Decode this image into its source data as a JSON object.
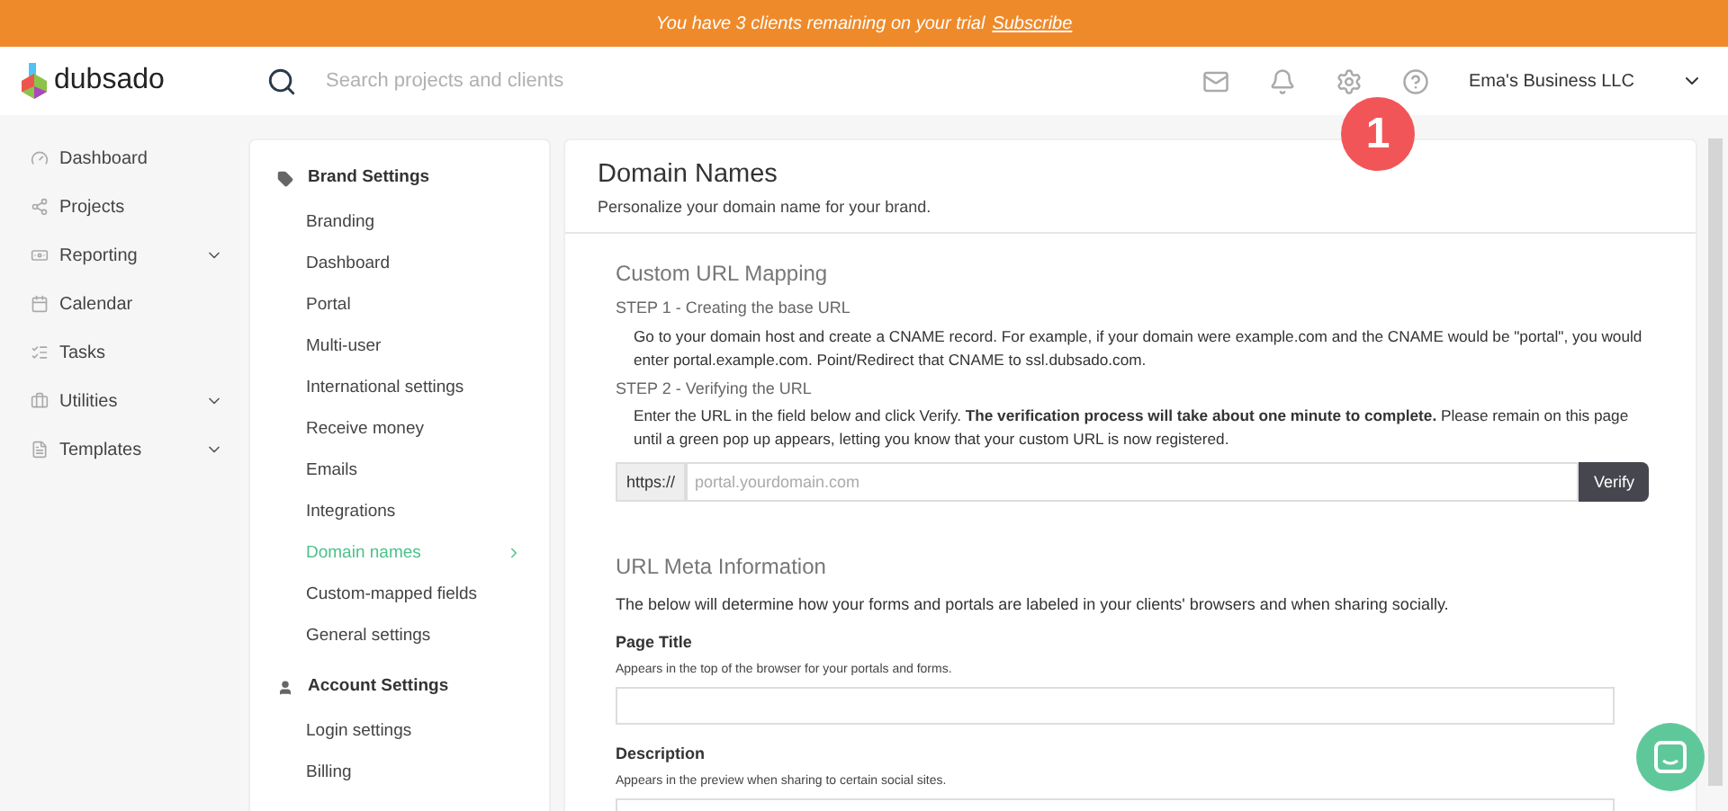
{
  "banner": {
    "text": "You have 3 clients remaining on your trial",
    "link": "Subscribe"
  },
  "header": {
    "logo": "dubsado",
    "search": {
      "placeholder": "Search projects and clients"
    },
    "account": "Ema's Business LLC",
    "badge": "1"
  },
  "nav": [
    {
      "label": "Dashboard",
      "expandable": false
    },
    {
      "label": "Projects",
      "expandable": false
    },
    {
      "label": "Reporting",
      "expandable": true
    },
    {
      "label": "Calendar",
      "expandable": false
    },
    {
      "label": "Tasks",
      "expandable": false
    },
    {
      "label": "Utilities",
      "expandable": true
    },
    {
      "label": "Templates",
      "expandable": true
    }
  ],
  "settings": [
    {
      "title": "Brand Settings",
      "items": [
        {
          "label": "Branding",
          "selected": false
        },
        {
          "label": "Dashboard",
          "selected": false
        },
        {
          "label": "Portal",
          "selected": false
        },
        {
          "label": "Multi-user",
          "selected": false
        },
        {
          "label": "International settings",
          "selected": false
        },
        {
          "label": "Receive money",
          "selected": false
        },
        {
          "label": "Emails",
          "selected": false
        },
        {
          "label": "Integrations",
          "selected": false
        },
        {
          "label": "Domain names",
          "selected": true
        },
        {
          "label": "Custom-mapped fields",
          "selected": false
        },
        {
          "label": "General settings",
          "selected": false
        }
      ]
    },
    {
      "title": "Account Settings",
      "items": [
        {
          "label": "Login settings",
          "selected": false
        },
        {
          "label": "Billing",
          "selected": false
        }
      ]
    }
  ],
  "page": {
    "title": "Domain Names",
    "subtitle": "Personalize your domain name for your brand.",
    "mapping": {
      "heading": "Custom URL Mapping",
      "steps": [
        {
          "title": "STEP 1 - Creating the base URL",
          "text": "Go to your domain host and create a CNAME record. For example, if your domain were example.com and the CNAME would be \"portal\", you would enter portal.example.com. Point/Redirect that CNAME to ssl.dubsado.com."
        },
        {
          "title": "STEP 2 - Verifying the URL",
          "text": "Enter the URL in the field below and click Verify. **The verification process will take about one minute to complete.** Please remain on this page until a green pop up appears, letting you know that your custom URL is now registered."
        }
      ],
      "prefix": "https://",
      "placeholder": "portal.yourdomain.com",
      "button": "Verify"
    },
    "meta": {
      "heading": "URL Meta Information",
      "intro": "The below will determine how your forms and portals are labeled in your clients' browsers and when sharing socially.",
      "fields": [
        {
          "label": "Page Title",
          "hint": "Appears in the top of the browser for your portals and forms.",
          "kind": "input"
        },
        {
          "label": "Description",
          "hint": "Appears in the preview when sharing to certain social sites.",
          "kind": "textarea"
        }
      ]
    }
  }
}
